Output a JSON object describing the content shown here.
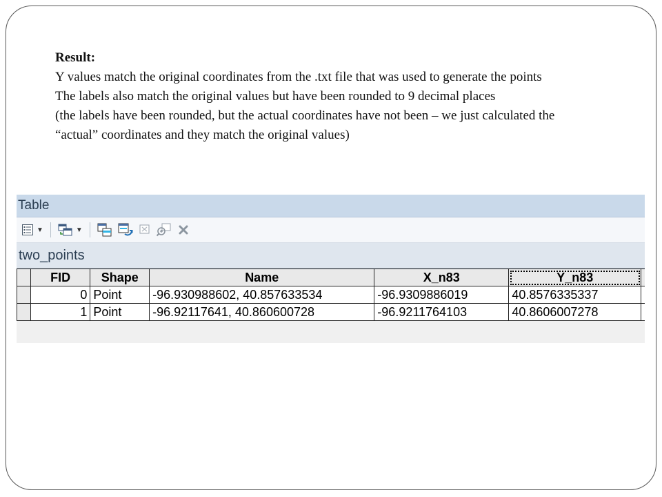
{
  "slide": {
    "lines": [
      "Result:",
      "Y values match the original coordinates from the .txt file that was used to generate the points",
      "The labels also match the original values but have been rounded to 9 decimal places",
      "(the labels have been rounded, but the actual coordinates have not been – we just calculated the",
      "“actual” coordinates and they match the original values)"
    ]
  },
  "window": {
    "title": "Table",
    "tab": "two_points",
    "toolbar": {
      "icons": [
        "table-options-icon",
        "related-tables-icon",
        "select-by-attributes-icon",
        "switch-selection-icon",
        "clear-selection-icon",
        "zoom-to-selected-icon",
        "delete-selected-icon"
      ]
    }
  },
  "table": {
    "columns": [
      "FID",
      "Shape",
      "Name",
      "X_n83",
      "Y_n83"
    ],
    "selected_column": "Y_n83",
    "rows": [
      {
        "fid": "0",
        "shape": "Point",
        "name": "-96.930988602, 40.857633534",
        "x": "-96.9309886019",
        "y": "40.8576335337"
      },
      {
        "fid": "1",
        "shape": "Point",
        "name": "-96.92117641, 40.860600728",
        "x": "-96.9211764103",
        "y": "40.8606007278"
      }
    ]
  }
}
